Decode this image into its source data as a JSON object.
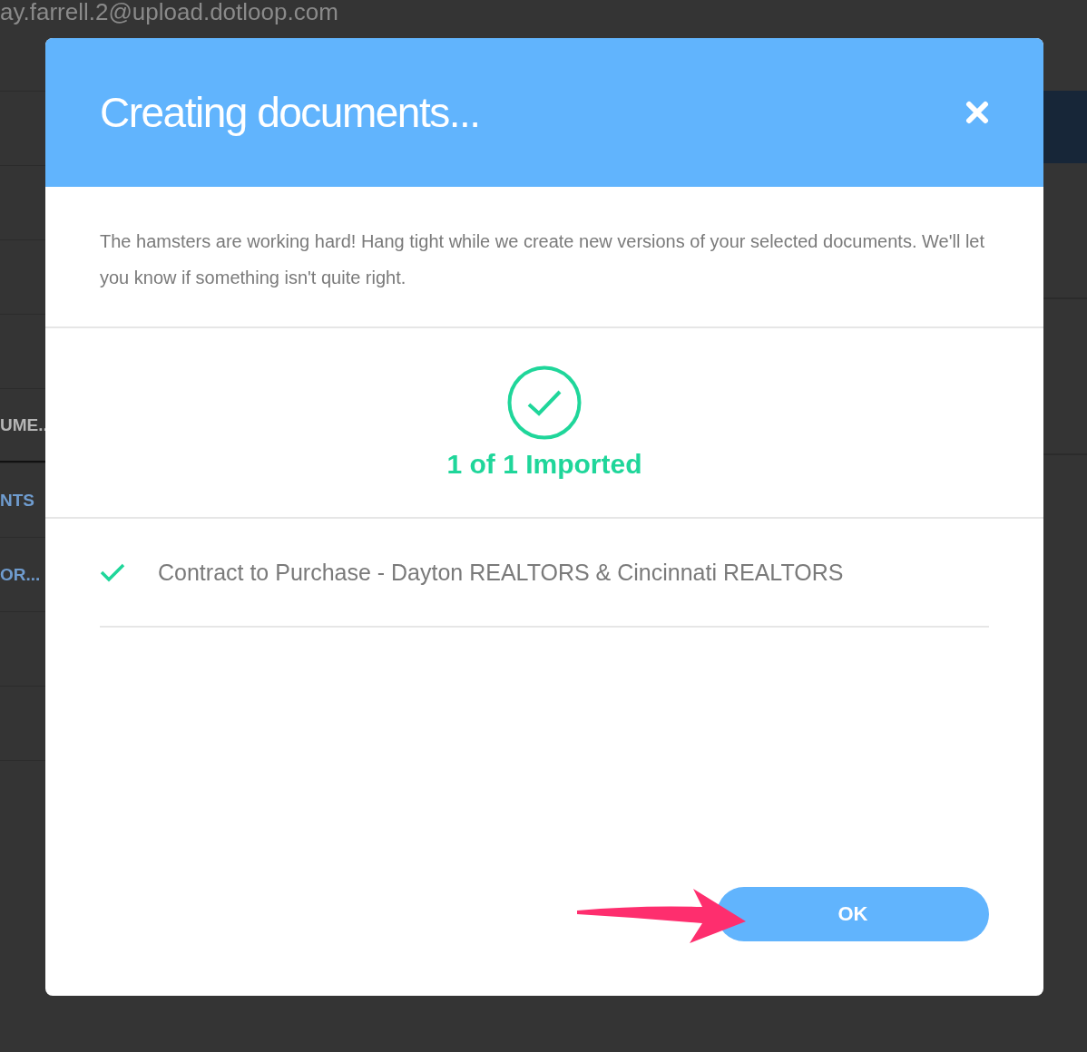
{
  "background": {
    "email": "ay.farrell.2@upload.dotloop.com",
    "tabs": [
      {
        "label": "UME..",
        "selected": true
      },
      {
        "label": "NTS",
        "selected": false
      },
      {
        "label": "OR...",
        "selected": false
      }
    ]
  },
  "dialog": {
    "title": "Creating documents...",
    "message": "The hamsters are working hard! Hang tight while we create new versions of your selected documents. We'll let you know if something isn't quite right.",
    "status": "1 of 1 Imported",
    "documents": [
      {
        "name": "Contract to Purchase - Dayton REALTORS & Cincinnati REALTORS",
        "done": true
      }
    ],
    "buttons": [
      {
        "label": "OK"
      }
    ]
  }
}
